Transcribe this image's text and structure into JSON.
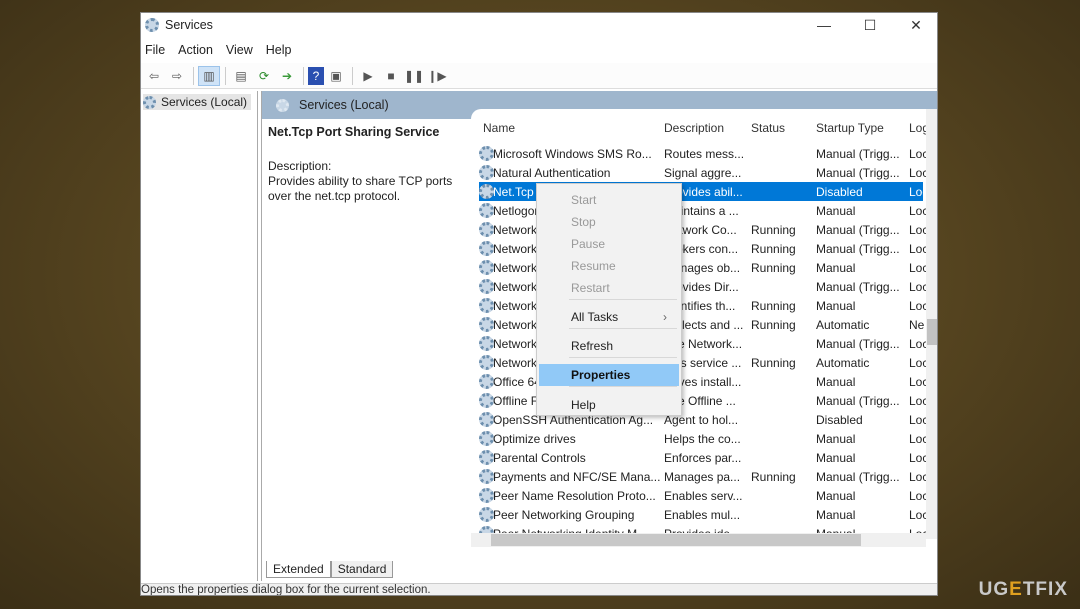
{
  "window": {
    "title": "Services",
    "minimize": "—",
    "maximize": "☐",
    "close": "✕"
  },
  "menu": [
    "File",
    "Action",
    "View",
    "Help"
  ],
  "tree": {
    "root": "Services (Local)"
  },
  "panel": {
    "header": "Services (Local)",
    "service_title": "Net.Tcp Port Sharing Service",
    "description_label": "Description:",
    "description": "Provides ability to share TCP ports over the net.tcp protocol."
  },
  "columns": [
    "Name",
    "Description",
    "Status",
    "Startup Type",
    "Log"
  ],
  "rows": [
    [
      "Microsoft Windows SMS Ro...",
      "Routes mess...",
      "",
      "Manual (Trigg...",
      "Loc"
    ],
    [
      "Natural Authentication",
      "Signal aggre...",
      "",
      "Manual (Trigg...",
      "Loc"
    ],
    [
      "Net.Tcp",
      "Provides abil...",
      "",
      "Disabled",
      "Loc"
    ],
    [
      "Netlogon",
      "Maintains a ...",
      "",
      "Manual",
      "Loc"
    ],
    [
      "Network",
      "Network Co...",
      "Running",
      "Manual (Trigg...",
      "Loc"
    ],
    [
      "Network",
      "Brokers con...",
      "Running",
      "Manual (Trigg...",
      "Loc"
    ],
    [
      "Network",
      "Manages ob...",
      "Running",
      "Manual",
      "Loc"
    ],
    [
      "Network",
      "Provides Dir...",
      "",
      "Manual (Trigg...",
      "Loc"
    ],
    [
      "Network",
      "Identifies th...",
      "Running",
      "Manual",
      "Loc"
    ],
    [
      "Network",
      "Collects and ...",
      "Running",
      "Automatic",
      "Ne"
    ],
    [
      "Network",
      "The Network...",
      "",
      "Manual (Trigg...",
      "Loc"
    ],
    [
      "Network",
      "This service ...",
      "Running",
      "Automatic",
      "Loc"
    ],
    [
      "Office 64",
      "Saves install...",
      "",
      "Manual",
      "Loc"
    ],
    [
      "Offline Files",
      "The Offline ...",
      "",
      "Manual (Trigg...",
      "Loc"
    ],
    [
      "OpenSSH Authentication Ag...",
      "Agent to hol...",
      "",
      "Disabled",
      "Loc"
    ],
    [
      "Optimize drives",
      "Helps the co...",
      "",
      "Manual",
      "Loc"
    ],
    [
      "Parental Controls",
      "Enforces par...",
      "",
      "Manual",
      "Loc"
    ],
    [
      "Payments and NFC/SE Mana...",
      "Manages pa...",
      "Running",
      "Manual (Trigg...",
      "Loc"
    ],
    [
      "Peer Name Resolution Proto...",
      "Enables serv...",
      "",
      "Manual",
      "Loc"
    ],
    [
      "Peer Networking Grouping",
      "Enables mul...",
      "",
      "Manual",
      "Loc"
    ],
    [
      "Peer Networking Identity M...",
      "Provides ide...",
      "",
      "Manual",
      "Loc"
    ]
  ],
  "selected_row": 2,
  "context_menu": {
    "items": [
      {
        "label": "Start",
        "enabled": false
      },
      {
        "label": "Stop",
        "enabled": false
      },
      {
        "label": "Pause",
        "enabled": false
      },
      {
        "label": "Resume",
        "enabled": false
      },
      {
        "label": "Restart",
        "enabled": false
      },
      {
        "label": "All Tasks",
        "enabled": true,
        "submenu": "›"
      },
      {
        "label": "Refresh",
        "enabled": true
      },
      {
        "label": "Properties",
        "enabled": true,
        "highlighted": true
      },
      {
        "label": "Help",
        "enabled": true
      }
    ]
  },
  "tabs": [
    "Extended",
    "Standard"
  ],
  "status": "Opens the properties dialog box for the current selection.",
  "watermark": "UGETFIX",
  "colors": {
    "selection": "#0078d7",
    "menu_highlight": "#91c9f7",
    "header_band": "#9fb6cd"
  }
}
